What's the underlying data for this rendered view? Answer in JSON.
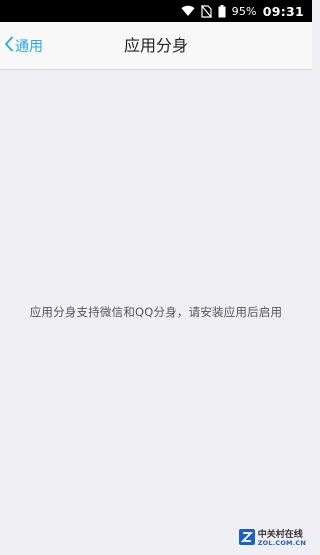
{
  "status_bar": {
    "battery_percent": "95%",
    "time": "09:31",
    "icons": [
      "wifi-icon",
      "no-sim-icon",
      "battery-icon"
    ]
  },
  "nav": {
    "back_label": "通用",
    "title": "应用分身"
  },
  "body": {
    "message": "应用分身支持微信和QQ分身，请安装应用后启用"
  },
  "watermark": {
    "cn": "中关村在线",
    "en": "ZOL.COM.CN"
  },
  "colors": {
    "accent": "#2aa8e8",
    "background": "#efeff4",
    "navbar": "#f8f8f8",
    "status_bar": "#000000",
    "text_primary": "#222222",
    "text_secondary": "#555555"
  }
}
